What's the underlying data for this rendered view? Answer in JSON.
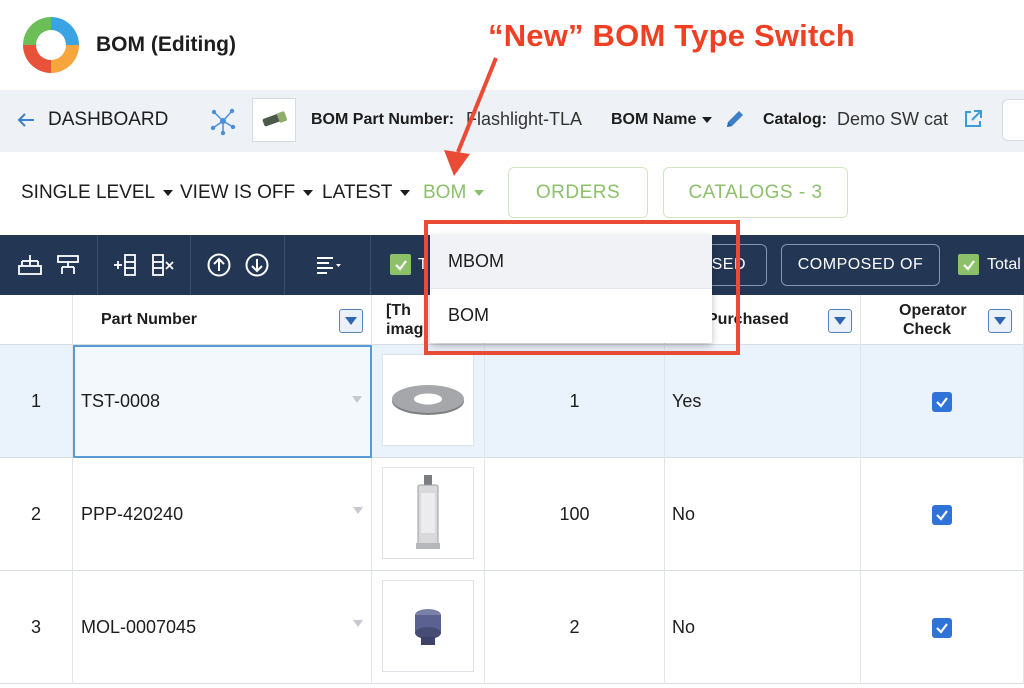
{
  "header": {
    "app_title": "BOM (Editing)",
    "annotation": "“New” BOM Type Switch"
  },
  "context": {
    "back_label": "DASHBOARD",
    "part_number_label": "BOM Part Number:",
    "part_number_value": "Flashlight-TLA",
    "bom_name_label": "BOM Name",
    "catalog_label": "Catalog:",
    "catalog_value": "Demo SW cat"
  },
  "tabs": {
    "level": "SINGLE LEVEL",
    "view": "VIEW IS OFF",
    "version": "LATEST",
    "bom_type": "BOM",
    "orders": "ORDERS",
    "catalogs": "CATALOGS - 3"
  },
  "toolbar": {
    "checkbox_1_label": "T",
    "used_btn": "SED",
    "composed_of_btn": "COMPOSED OF",
    "total_label": "Total"
  },
  "bom_type_menu": {
    "options": [
      "MBOM",
      "BOM"
    ]
  },
  "grid": {
    "columns": {
      "part_number": "Part Number",
      "thumbnail_line1": "[Th",
      "thumbnail_line2": "imag",
      "purchased": "Purchased",
      "operator_check_line1": "Operator",
      "operator_check_line2": "Check"
    },
    "rows": [
      {
        "index": "1",
        "part_number": "TST-0008",
        "quantity": "1",
        "purchased": "Yes",
        "operator_check": true,
        "thumbnail": "washer"
      },
      {
        "index": "2",
        "part_number": "PPP-420240",
        "quantity": "100",
        "purchased": "No",
        "operator_check": true,
        "thumbnail": "glue-tube"
      },
      {
        "index": "3",
        "part_number": "MOL-0007045",
        "quantity": "2",
        "purchased": "No",
        "operator_check": true,
        "thumbnail": "connector"
      }
    ]
  },
  "colors": {
    "toolbar_bg": "#233654",
    "accent_green": "#8cc06a",
    "annotation_red": "#ef4023",
    "checkbox_blue": "#2f73d9"
  }
}
